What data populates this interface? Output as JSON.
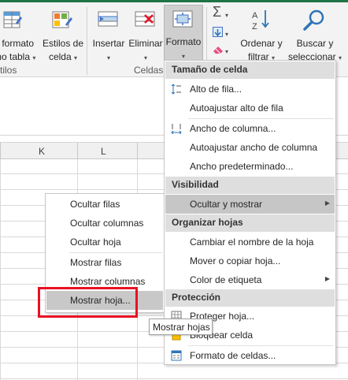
{
  "ribbon": {
    "format_as_table": {
      "line1": "r formato",
      "line2": "mo tabla"
    },
    "cell_styles": {
      "line1": "Estilos de",
      "line2": "celda"
    },
    "insert": {
      "label": "Insertar"
    },
    "delete": {
      "label": "Eliminar"
    },
    "format": {
      "label": "Formato"
    },
    "sort_filter": {
      "line1": "Ordenar y",
      "line2": "filtrar"
    },
    "find_select": {
      "line1": "Buscar y",
      "line2": "seleccionar"
    },
    "group_styles": "tilos",
    "group_cells": "Celdas",
    "dropdown_arrow": "▾"
  },
  "columns": [
    "K",
    "L"
  ],
  "format_menu": {
    "sections": {
      "cell_size": "Tamaño de celda",
      "visibility": "Visibilidad",
      "organize": "Organizar hojas",
      "protection": "Protección"
    },
    "items": {
      "row_height": "Alto de fila...",
      "autofit_row": "Autoajustar alto de fila",
      "column_width": "Ancho de columna...",
      "autofit_column": "Autoajustar ancho de columna",
      "default_width": "Ancho predeterminado...",
      "hide_unhide": "Ocultar y mostrar",
      "rename_sheet": "Cambiar el nombre de la hoja",
      "move_copy_sheet": "Mover o copiar hoja...",
      "tab_color": "Color de etiqueta",
      "protect_sheet": "Proteger hoja...",
      "lock_cell": "Bloquear celda",
      "format_cells": "Formato de celdas..."
    },
    "submenu_arrow": "▶"
  },
  "hide_submenu": {
    "items": {
      "hide_rows": "Ocultar filas",
      "hide_columns": "Ocultar columnas",
      "hide_sheet": "Ocultar hoja",
      "unhide_rows": "Mostrar filas",
      "unhide_columns": "Mostrar columnas",
      "unhide_sheet": "Mostrar hoja..."
    }
  },
  "tooltip": "Mostrar hojas",
  "colors": {
    "excel_green": "#217346",
    "highlight_red": "#e81123",
    "menu_highlight": "#c6c6c6",
    "section_bg": "#dedede"
  }
}
